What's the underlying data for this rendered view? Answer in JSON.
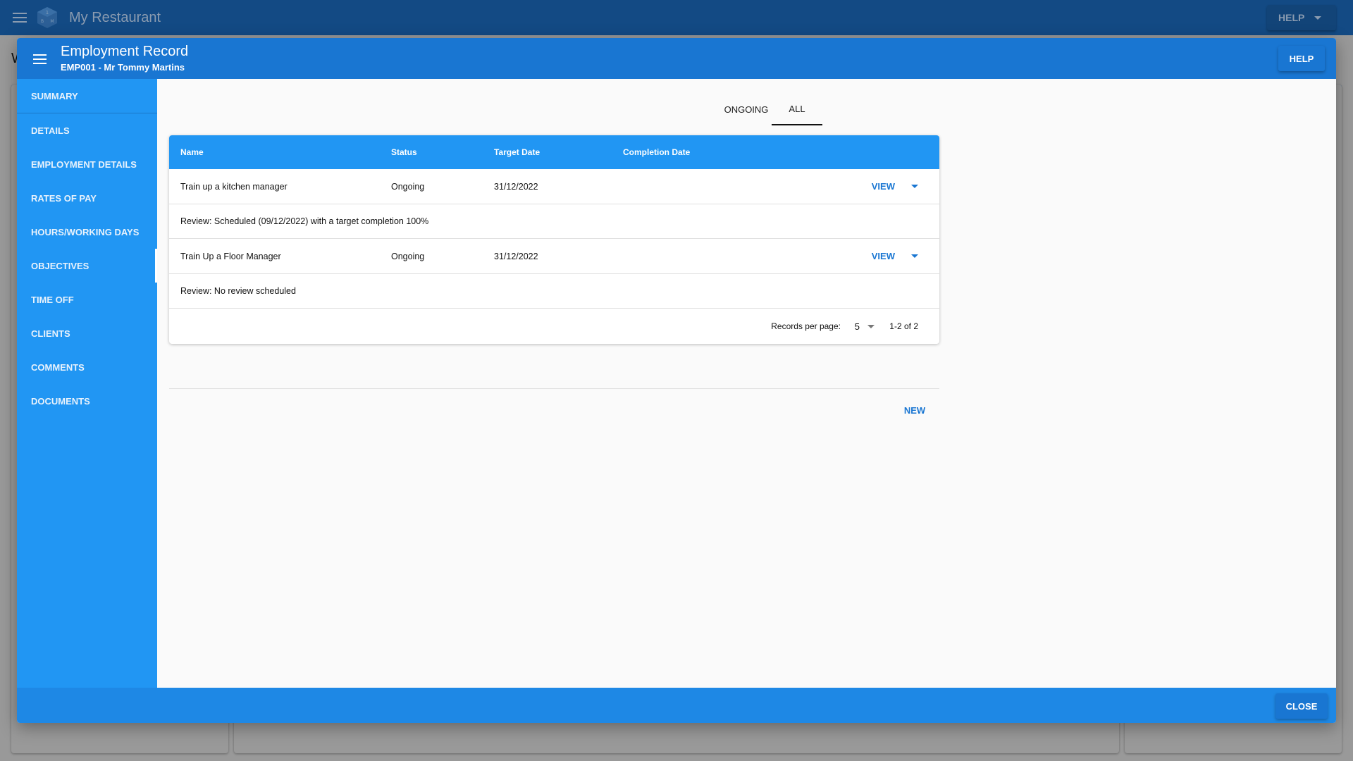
{
  "app": {
    "title": "My Restaurant",
    "help_label": "HELP",
    "background_letter": "W"
  },
  "dialog": {
    "title": "Employment Record",
    "subtitle": "EMP001 - Mr Tommy Martins",
    "help_label": "HELP",
    "close_label": "CLOSE"
  },
  "sidebar": {
    "active": "OBJECTIVES",
    "items": [
      {
        "label": "SUMMARY"
      },
      {
        "label": "DETAILS"
      },
      {
        "label": "EMPLOYMENT DETAILS"
      },
      {
        "label": "RATES OF PAY"
      },
      {
        "label": "HOURS/WORKING DAYS"
      },
      {
        "label": "OBJECTIVES"
      },
      {
        "label": "TIME OFF"
      },
      {
        "label": "CLIENTS"
      },
      {
        "label": "COMMENTS"
      },
      {
        "label": "DOCUMENTS"
      }
    ]
  },
  "tabs": {
    "items": [
      {
        "label": "ONGOING"
      },
      {
        "label": "ALL"
      }
    ],
    "selected": "ALL"
  },
  "table": {
    "columns": [
      "Name",
      "Status",
      "Target Date",
      "Completion Date"
    ],
    "rows": [
      {
        "name": "Train up a kitchen manager",
        "status": "Ongoing",
        "target_date": "31/12/2022",
        "completion_date": "",
        "action": "VIEW",
        "review": "Review: Scheduled (09/12/2022) with a target completion 100%"
      },
      {
        "name": "Train Up a Floor Manager",
        "status": "Ongoing",
        "target_date": "31/12/2022",
        "completion_date": "",
        "action": "VIEW",
        "review": "Review: No review scheduled"
      }
    ],
    "pagination": {
      "records_per_page_label": "Records per page:",
      "records_per_page": "5",
      "range": "1-2 of 2"
    }
  },
  "actions": {
    "new_label": "NEW"
  },
  "colors": {
    "appbar": "#134a84",
    "dialog_header": "#1976d2",
    "sidebar": "#2196f3",
    "footer": "#1e88e5",
    "accent": "#1976d2"
  }
}
